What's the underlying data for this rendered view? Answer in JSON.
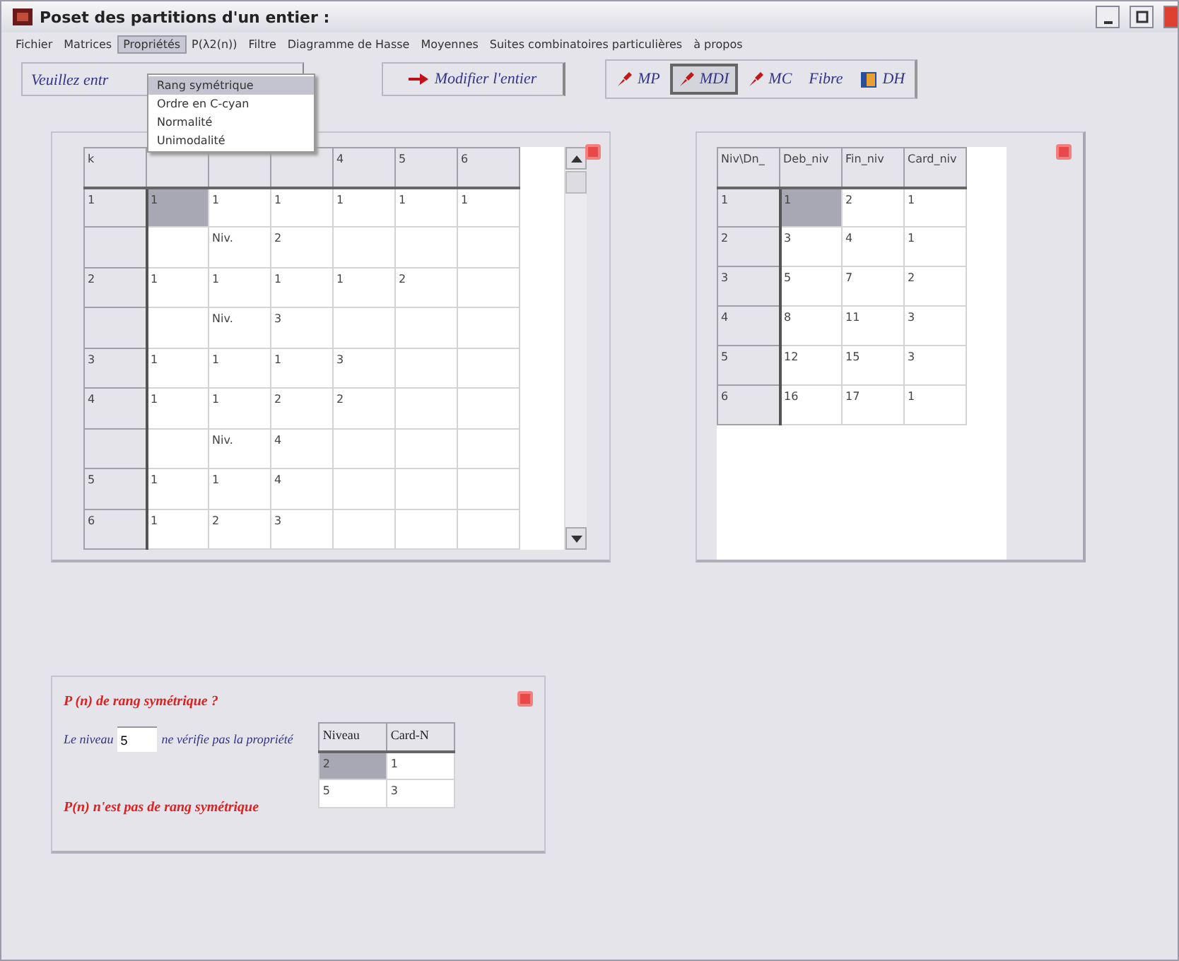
{
  "window": {
    "title": "Poset des partitions d'un entier :"
  },
  "menu": [
    {
      "label": "Fichier",
      "selected": false
    },
    {
      "label": "Matrices",
      "selected": false
    },
    {
      "label": "Propriétés",
      "selected": true
    },
    {
      "label": "P(λ2(n))",
      "selected": false
    },
    {
      "label": "Filtre",
      "selected": false
    },
    {
      "label": "Diagramme de Hasse",
      "selected": false
    },
    {
      "label": "Moyennes",
      "selected": false
    },
    {
      "label": "Suites combinatoires particulières",
      "selected": false
    },
    {
      "label": "à propos",
      "selected": false
    }
  ],
  "dropdown": [
    {
      "label": "Rang symétrique",
      "selected": true
    },
    {
      "label": "Ordre en C-cyan",
      "selected": false
    },
    {
      "label": "Normalité",
      "selected": false
    },
    {
      "label": "Unimodalité",
      "selected": false
    }
  ],
  "prompt": "Veuillez entr",
  "modify_button": "Modifier l'entier",
  "tools": [
    {
      "label": "MP",
      "kind": "arrow",
      "selected": false
    },
    {
      "label": "MDI",
      "kind": "arrow",
      "selected": true
    },
    {
      "label": "MC",
      "kind": "arrow",
      "selected": false
    },
    {
      "label": "Fibre",
      "kind": "text",
      "selected": false
    },
    {
      "label": "DH",
      "kind": "book",
      "selected": false
    }
  ],
  "left_table": {
    "columns": [
      {
        "label": "k"
      },
      {},
      {},
      {},
      {
        "label": "4"
      },
      {
        "label": "5"
      },
      {
        "label": "6"
      }
    ],
    "rows": [
      {
        "cells": [
          {
            "kind": "header",
            "text": "1"
          },
          {
            "text": "1",
            "selected": true
          },
          {
            "text": "1",
            "selected": false
          },
          {
            "text": "1",
            "selected": false
          },
          {
            "text": "1",
            "selected": false
          },
          {
            "text": "1",
            "selected": false
          },
          {
            "text": "1",
            "selected": false
          }
        ]
      },
      {
        "cells": [
          {
            "kind": "header"
          },
          {
            "selected": false
          },
          {
            "text": "Niv.",
            "selected": false
          },
          {
            "text": "2",
            "selected": false
          },
          {
            "selected": false
          },
          {
            "selected": false
          },
          {
            "selected": false
          }
        ]
      },
      {
        "cells": [
          {
            "kind": "header",
            "text": "2"
          },
          {
            "text": "1",
            "selected": false
          },
          {
            "text": "1",
            "selected": false
          },
          {
            "text": "1",
            "selected": false
          },
          {
            "text": "1",
            "selected": false
          },
          {
            "text": "2",
            "selected": false
          },
          {
            "selected": false
          }
        ]
      },
      {
        "cells": [
          {
            "kind": "header"
          },
          {
            "selected": false
          },
          {
            "text": "Niv.",
            "selected": false
          },
          {
            "text": "3",
            "selected": false
          },
          {
            "selected": false
          },
          {
            "selected": false
          },
          {
            "selected": false
          }
        ]
      },
      {
        "cells": [
          {
            "kind": "header",
            "text": "3"
          },
          {
            "text": "1",
            "selected": false
          },
          {
            "text": "1",
            "selected": false
          },
          {
            "text": "1",
            "selected": false
          },
          {
            "text": "3",
            "selected": false
          },
          {
            "selected": false
          },
          {
            "selected": false
          }
        ]
      },
      {
        "cells": [
          {
            "kind": "header",
            "text": "4"
          },
          {
            "text": "1",
            "selected": false
          },
          {
            "text": "1",
            "selected": false
          },
          {
            "text": "2",
            "selected": false
          },
          {
            "text": "2",
            "selected": false
          },
          {
            "selected": false
          },
          {
            "selected": false
          }
        ]
      },
      {
        "cells": [
          {
            "kind": "header"
          },
          {
            "selected": false
          },
          {
            "text": "Niv.",
            "selected": false
          },
          {
            "text": "4",
            "selected": false
          },
          {
            "selected": false
          },
          {
            "selected": false
          },
          {
            "selected": false
          }
        ]
      },
      {
        "cells": [
          {
            "kind": "header",
            "text": "5"
          },
          {
            "text": "1",
            "selected": false
          },
          {
            "text": "1",
            "selected": false
          },
          {
            "text": "4",
            "selected": false
          },
          {
            "selected": false
          },
          {
            "selected": false
          },
          {
            "selected": false
          }
        ]
      },
      {
        "cells": [
          {
            "kind": "header",
            "text": "6"
          },
          {
            "text": "1",
            "selected": false
          },
          {
            "text": "2",
            "selected": false
          },
          {
            "text": "3",
            "selected": false
          },
          {
            "selected": false
          },
          {
            "selected": false
          },
          {
            "selected": false
          }
        ]
      }
    ]
  },
  "right_table": {
    "columns": [
      {
        "label": "Niv\\Dn_"
      },
      {
        "label": "Deb_niv"
      },
      {
        "label": "Fin_niv"
      },
      {
        "label": "Card_niv"
      }
    ],
    "rows": [
      {
        "cells": [
          {
            "kind": "header",
            "text": "1"
          },
          {
            "text": "1",
            "selected": true
          },
          {
            "text": "2",
            "selected": false
          },
          {
            "text": "1",
            "selected": false
          }
        ]
      },
      {
        "cells": [
          {
            "kind": "header",
            "text": "2"
          },
          {
            "text": "3",
            "selected": false
          },
          {
            "text": "4",
            "selected": false
          },
          {
            "text": "1",
            "selected": false
          }
        ]
      },
      {
        "cells": [
          {
            "kind": "header",
            "text": "3"
          },
          {
            "text": "5",
            "selected": false
          },
          {
            "text": "7",
            "selected": false
          },
          {
            "text": "2",
            "selected": false
          }
        ]
      },
      {
        "cells": [
          {
            "kind": "header",
            "text": "4"
          },
          {
            "text": "8",
            "selected": false
          },
          {
            "text": "11",
            "selected": false
          },
          {
            "text": "3",
            "selected": false
          }
        ]
      },
      {
        "cells": [
          {
            "kind": "header",
            "text": "5"
          },
          {
            "text": "12",
            "selected": false
          },
          {
            "text": "15",
            "selected": false
          },
          {
            "text": "3",
            "selected": false
          }
        ]
      },
      {
        "cells": [
          {
            "kind": "header",
            "text": "6"
          },
          {
            "text": "16",
            "selected": false
          },
          {
            "text": "17",
            "selected": false
          },
          {
            "text": "1",
            "selected": false
          }
        ]
      }
    ]
  },
  "symmetry_panel": {
    "title": "P (n) de rang symétrique ?",
    "level_label": "Le niveau",
    "level_value": "5",
    "level_text": "ne vérifie pas la propriété",
    "result": "P(n) n'est pas de rang symétrique",
    "table": {
      "columns": [
        {
          "label": "Niveau"
        },
        {
          "label": "Card-N"
        }
      ],
      "rows": [
        {
          "cells": [
            {
              "text": "2",
              "selected": true
            },
            {
              "text": "1",
              "selected": false
            }
          ]
        },
        {
          "cells": [
            {
              "text": "5",
              "selected": false
            },
            {
              "text": "3",
              "selected": false
            }
          ]
        }
      ]
    }
  }
}
